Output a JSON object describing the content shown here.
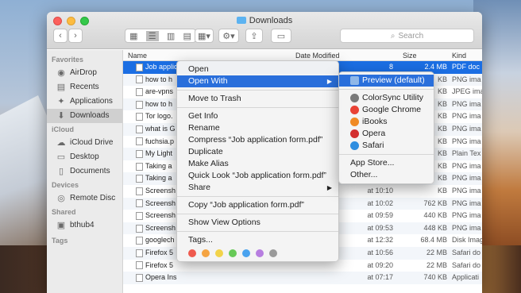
{
  "window": {
    "title": "Downloads"
  },
  "toolbar": {
    "back": "‹",
    "forward": "›",
    "search_placeholder": "Search"
  },
  "sidebar": {
    "sections": [
      {
        "label": "Favorites",
        "items": [
          {
            "label": "AirDrop",
            "icon": "airdrop-icon"
          },
          {
            "label": "Recents",
            "icon": "recents-icon"
          },
          {
            "label": "Applications",
            "icon": "applications-icon"
          },
          {
            "label": "Downloads",
            "icon": "downloads-icon",
            "selected": true
          }
        ]
      },
      {
        "label": "iCloud",
        "items": [
          {
            "label": "iCloud Drive",
            "icon": "cloud-icon"
          },
          {
            "label": "Desktop",
            "icon": "desktop-icon"
          },
          {
            "label": "Documents",
            "icon": "documents-icon"
          }
        ]
      },
      {
        "label": "Devices",
        "items": [
          {
            "label": "Remote Disc",
            "icon": "disc-icon"
          }
        ]
      },
      {
        "label": "Shared",
        "items": [
          {
            "label": "bthub4",
            "icon": "computer-icon"
          }
        ]
      },
      {
        "label": "Tags",
        "items": []
      }
    ]
  },
  "columns": {
    "name": "Name",
    "date": "Date Modified",
    "size": "Size",
    "kind": "Kind"
  },
  "files": [
    {
      "name": "Job applic",
      "date": "8",
      "size": "2.4 MB",
      "kind": "PDF doc",
      "selected": true
    },
    {
      "name": "how to h",
      "date": "",
      "size": "KB",
      "kind": "PNG ima"
    },
    {
      "name": "are-vpns",
      "date": "",
      "size": "KB",
      "kind": "JPEG ima"
    },
    {
      "name": "how to h",
      "date": "",
      "size": "KB",
      "kind": "PNG ima"
    },
    {
      "name": "Tor logo.",
      "date": "",
      "size": "KB",
      "kind": "PNG ima"
    },
    {
      "name": "what is G",
      "date": "",
      "size": "KB",
      "kind": "PNG ima"
    },
    {
      "name": "fuchsia.p",
      "date": "",
      "size": "KB",
      "kind": "PNG ima"
    },
    {
      "name": "My Light",
      "date": "",
      "size": "KB",
      "kind": "Plain Tex"
    },
    {
      "name": "Taking a",
      "date": "",
      "size": "KB",
      "kind": "PNG ima"
    },
    {
      "name": "Taking a",
      "date": "",
      "size": "KB",
      "kind": "PNG ima"
    },
    {
      "name": "Screensh",
      "date": "at 10:10",
      "size": "KB",
      "kind": "PNG ima"
    },
    {
      "name": "Screensh",
      "date": "at 10:02",
      "size": "762 KB",
      "kind": "PNG ima"
    },
    {
      "name": "Screensh",
      "date": "at 09:59",
      "size": "440 KB",
      "kind": "PNG ima"
    },
    {
      "name": "Screensh",
      "date": "at 09:53",
      "size": "448 KB",
      "kind": "PNG ima"
    },
    {
      "name": "googlech",
      "date": "at 12:32",
      "size": "68.4 MB",
      "kind": "Disk Imag"
    },
    {
      "name": "Firefox 5",
      "date": "at 10:56",
      "size": "22 MB",
      "kind": "Safari do"
    },
    {
      "name": "Firefox 5",
      "date": "at 09:20",
      "size": "22 MB",
      "kind": "Safari do"
    },
    {
      "name": "Opera Ins",
      "date": "at 07:17",
      "size": "740 KB",
      "kind": "Applicati"
    }
  ],
  "context_menu": {
    "items": [
      {
        "label": "Open"
      },
      {
        "label": "Open With",
        "submenu": true,
        "highlighted": true
      },
      {
        "sep": true
      },
      {
        "label": "Move to Trash"
      },
      {
        "sep": true
      },
      {
        "label": "Get Info"
      },
      {
        "label": "Rename"
      },
      {
        "label": "Compress “Job application form.pdf”"
      },
      {
        "label": "Duplicate"
      },
      {
        "label": "Make Alias"
      },
      {
        "label": "Quick Look “Job application form.pdf”"
      },
      {
        "label": "Share",
        "submenu": true
      },
      {
        "sep": true
      },
      {
        "label": "Copy “Job application form.pdf”"
      },
      {
        "sep": true
      },
      {
        "label": "Show View Options"
      },
      {
        "sep": true
      },
      {
        "label": "Tags..."
      }
    ],
    "tag_colors": [
      "#ef5a4e",
      "#f5a442",
      "#f2d34a",
      "#67c957",
      "#4aa3ef",
      "#b77ee0",
      "#9a9a9a"
    ]
  },
  "open_with_menu": {
    "items": [
      {
        "label": "Preview (default)",
        "highlighted": true,
        "icon": "preview-icon",
        "color": "#8fb7e8"
      },
      {
        "sep": true
      },
      {
        "label": "ColorSync Utility",
        "icon": "colorsync-icon",
        "color": "#7a7a7a"
      },
      {
        "label": "Google Chrome",
        "icon": "chrome-icon",
        "color": "#e94235"
      },
      {
        "label": "iBooks",
        "icon": "ibooks-icon",
        "color": "#f08a24"
      },
      {
        "label": "Opera",
        "icon": "opera-icon",
        "color": "#d32f2f"
      },
      {
        "label": "Safari",
        "icon": "safari-icon",
        "color": "#2f8ee0"
      },
      {
        "sep": true
      },
      {
        "label": "App Store..."
      },
      {
        "label": "Other..."
      }
    ]
  }
}
